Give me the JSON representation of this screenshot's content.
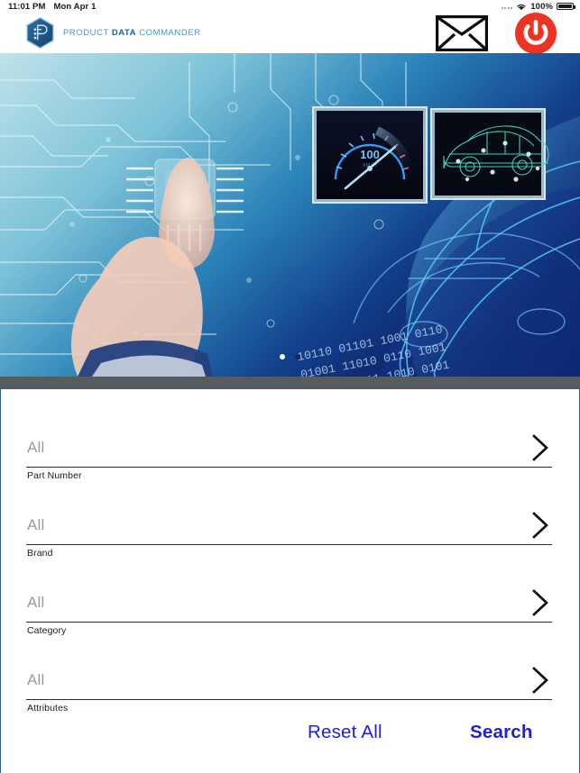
{
  "status_bar": {
    "time": "11:01 PM",
    "date": "Mon Apr 1",
    "battery_percent": "100%",
    "wifi_icon": "wifi-icon",
    "battery_icon": "battery-full-icon",
    "signal_icon": "cellular-signal-icon"
  },
  "header": {
    "logo_icon": "hexagon-p-logo-icon",
    "brand_word_1": "PRODUCT",
    "brand_word_2": "DATA",
    "brand_word_3": "COMMANDER",
    "mail_icon": "envelope-icon",
    "power_icon": "power-button-icon",
    "brand_color_light": "#4a97c9",
    "brand_color_dark": "#1565a8",
    "power_color": "#ed3424"
  },
  "hero": {
    "alt": "circuit board with finger touching sensor and blue wireframe car",
    "inset_gauge_icon": "speedometer-gauge-image",
    "inset_car_icon": "wireframe-car-image",
    "gauge_value": "100",
    "pagination": [
      {
        "label": "slide-1",
        "active": true
      },
      {
        "label": "slide-2",
        "active": false
      }
    ]
  },
  "search_form": {
    "fields": [
      {
        "value": "All",
        "label": "Part Number",
        "chevron_icon": "chevron-right-icon"
      },
      {
        "value": "All",
        "label": "Brand",
        "chevron_icon": "chevron-right-icon"
      },
      {
        "value": "All",
        "label": "Category",
        "chevron_icon": "chevron-right-icon"
      },
      {
        "value": "All",
        "label": "Attributes",
        "chevron_icon": "chevron-right-icon"
      }
    ],
    "reset_label": "Reset All",
    "search_label": "Search",
    "action_color": "#1f1fe0"
  }
}
